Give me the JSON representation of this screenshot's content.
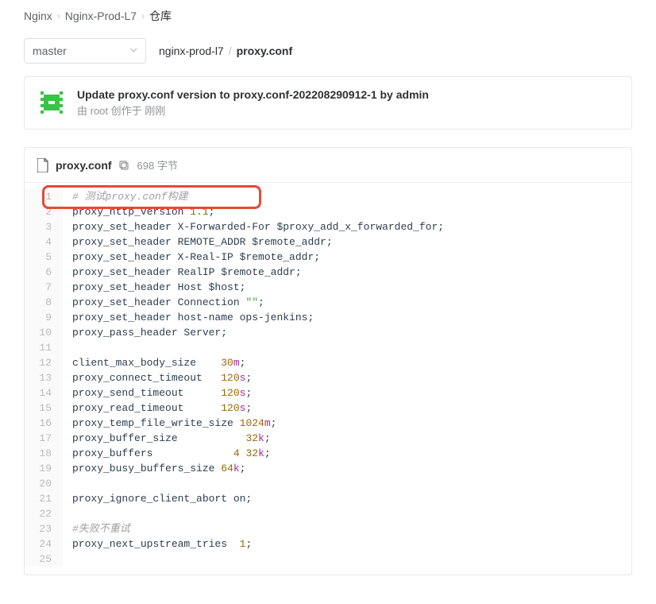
{
  "breadcrumb": {
    "items": [
      "Nginx",
      "Nginx-Prod-L7",
      "仓库"
    ]
  },
  "branch": "master",
  "path": {
    "dir": "nginx-prod-l7",
    "file": "proxy.conf"
  },
  "commit": {
    "title": "Update proxy.conf version to proxy.conf-202208290912-1 by admin",
    "byline": "由 root 创作于 刚刚"
  },
  "file": {
    "name": "proxy.conf",
    "size": "698 字节"
  },
  "code": [
    {
      "n": 1,
      "type": "comment",
      "text": "# 测试proxy.conf构建"
    },
    {
      "n": 2,
      "type": "plain",
      "tokens": [
        [
          "t",
          "proxy_http_version "
        ],
        [
          "n",
          "1.1"
        ],
        [
          "t",
          ";"
        ]
      ]
    },
    {
      "n": 3,
      "type": "plain",
      "tokens": [
        [
          "t",
          "proxy_set_header X-Forwarded-For $proxy_add_x_forwarded_for;"
        ]
      ]
    },
    {
      "n": 4,
      "type": "plain",
      "tokens": [
        [
          "t",
          "proxy_set_header REMOTE_ADDR $remote_addr;"
        ]
      ]
    },
    {
      "n": 5,
      "type": "plain",
      "tokens": [
        [
          "t",
          "proxy_set_header X-Real-IP $remote_addr;"
        ]
      ]
    },
    {
      "n": 6,
      "type": "plain",
      "tokens": [
        [
          "t",
          "proxy_set_header RealIP $remote_addr;"
        ]
      ]
    },
    {
      "n": 7,
      "type": "plain",
      "tokens": [
        [
          "t",
          "proxy_set_header Host $host;"
        ]
      ]
    },
    {
      "n": 8,
      "type": "plain",
      "tokens": [
        [
          "t",
          "proxy_set_header Connection "
        ],
        [
          "s",
          "\"\""
        ],
        [
          "t",
          ";"
        ]
      ]
    },
    {
      "n": 9,
      "type": "plain",
      "tokens": [
        [
          "t",
          "proxy_set_header host-name ops-jenkins;"
        ]
      ]
    },
    {
      "n": 10,
      "type": "plain",
      "tokens": [
        [
          "t",
          "proxy_pass_header Server;"
        ]
      ]
    },
    {
      "n": 11,
      "type": "plain",
      "tokens": [
        [
          "t",
          ""
        ]
      ]
    },
    {
      "n": 12,
      "type": "plain",
      "tokens": [
        [
          "t",
          "client_max_body_size    "
        ],
        [
          "n",
          "30"
        ],
        [
          "u",
          "m"
        ],
        [
          "t",
          ";"
        ]
      ]
    },
    {
      "n": 13,
      "type": "plain",
      "tokens": [
        [
          "t",
          "proxy_connect_timeout   "
        ],
        [
          "n",
          "120"
        ],
        [
          "u",
          "s"
        ],
        [
          "t",
          ";"
        ]
      ]
    },
    {
      "n": 14,
      "type": "plain",
      "tokens": [
        [
          "t",
          "proxy_send_timeout      "
        ],
        [
          "n",
          "120"
        ],
        [
          "u",
          "s"
        ],
        [
          "t",
          ";"
        ]
      ]
    },
    {
      "n": 15,
      "type": "plain",
      "tokens": [
        [
          "t",
          "proxy_read_timeout      "
        ],
        [
          "n",
          "120"
        ],
        [
          "u",
          "s"
        ],
        [
          "t",
          ";"
        ]
      ]
    },
    {
      "n": 16,
      "type": "plain",
      "tokens": [
        [
          "t",
          "proxy_temp_file_write_size "
        ],
        [
          "n",
          "1024"
        ],
        [
          "u",
          "m"
        ],
        [
          "t",
          ";"
        ]
      ]
    },
    {
      "n": 17,
      "type": "plain",
      "tokens": [
        [
          "t",
          "proxy_buffer_size           "
        ],
        [
          "n",
          "32"
        ],
        [
          "u",
          "k"
        ],
        [
          "t",
          ";"
        ]
      ]
    },
    {
      "n": 18,
      "type": "plain",
      "tokens": [
        [
          "t",
          "proxy_buffers             "
        ],
        [
          "n",
          "4"
        ],
        [
          "t",
          " "
        ],
        [
          "n",
          "32"
        ],
        [
          "u",
          "k"
        ],
        [
          "t",
          ";"
        ]
      ]
    },
    {
      "n": 19,
      "type": "plain",
      "tokens": [
        [
          "t",
          "proxy_busy_buffers_size "
        ],
        [
          "n",
          "64"
        ],
        [
          "u",
          "k"
        ],
        [
          "t",
          ";"
        ]
      ]
    },
    {
      "n": 20,
      "type": "plain",
      "tokens": [
        [
          "t",
          ""
        ]
      ]
    },
    {
      "n": 21,
      "type": "plain",
      "tokens": [
        [
          "t",
          "proxy_ignore_client_abort on;"
        ]
      ]
    },
    {
      "n": 22,
      "type": "plain",
      "tokens": [
        [
          "t",
          ""
        ]
      ]
    },
    {
      "n": 23,
      "type": "comment",
      "text": "#失败不重试"
    },
    {
      "n": 24,
      "type": "plain",
      "tokens": [
        [
          "t",
          "proxy_next_upstream_tries  "
        ],
        [
          "n",
          "1"
        ],
        [
          "t",
          ";"
        ]
      ]
    },
    {
      "n": 25,
      "type": "plain",
      "tokens": [
        [
          "t",
          ""
        ]
      ]
    }
  ]
}
